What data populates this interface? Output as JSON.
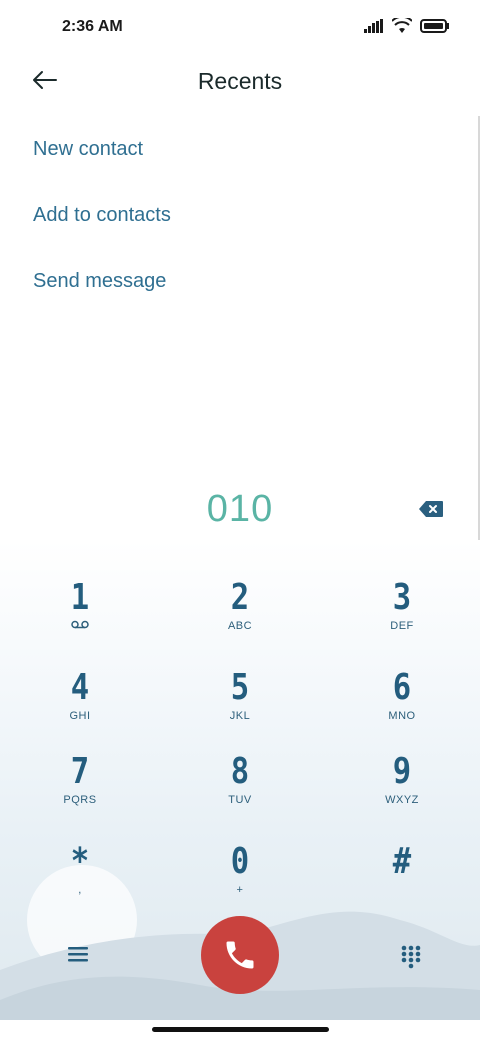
{
  "status": {
    "time": "2:36 AM"
  },
  "header": {
    "title": "Recents"
  },
  "actions": [
    "New contact",
    "Add to contacts",
    "Send message"
  ],
  "dialer": {
    "number": "010",
    "keys": [
      {
        "digit": "1",
        "sub": ""
      },
      {
        "digit": "2",
        "sub": "ABC"
      },
      {
        "digit": "3",
        "sub": "DEF"
      },
      {
        "digit": "4",
        "sub": "GHI"
      },
      {
        "digit": "5",
        "sub": "JKL"
      },
      {
        "digit": "6",
        "sub": "MNO"
      },
      {
        "digit": "7",
        "sub": "PQRS"
      },
      {
        "digit": "8",
        "sub": "TUV"
      },
      {
        "digit": "9",
        "sub": "WXYZ"
      },
      {
        "digit": "*",
        "sub": ","
      },
      {
        "digit": "0",
        "sub": "+"
      },
      {
        "digit": "#",
        "sub": ""
      }
    ]
  },
  "colors": {
    "accent": "#2f6f91",
    "number": "#5ab4a5",
    "call": "#c9423e",
    "key": "#245d7e"
  },
  "icons": [
    "back-arrow-icon",
    "backspace-icon",
    "voicemail-icon",
    "menu-icon",
    "phone-icon",
    "keypad-icon"
  ]
}
